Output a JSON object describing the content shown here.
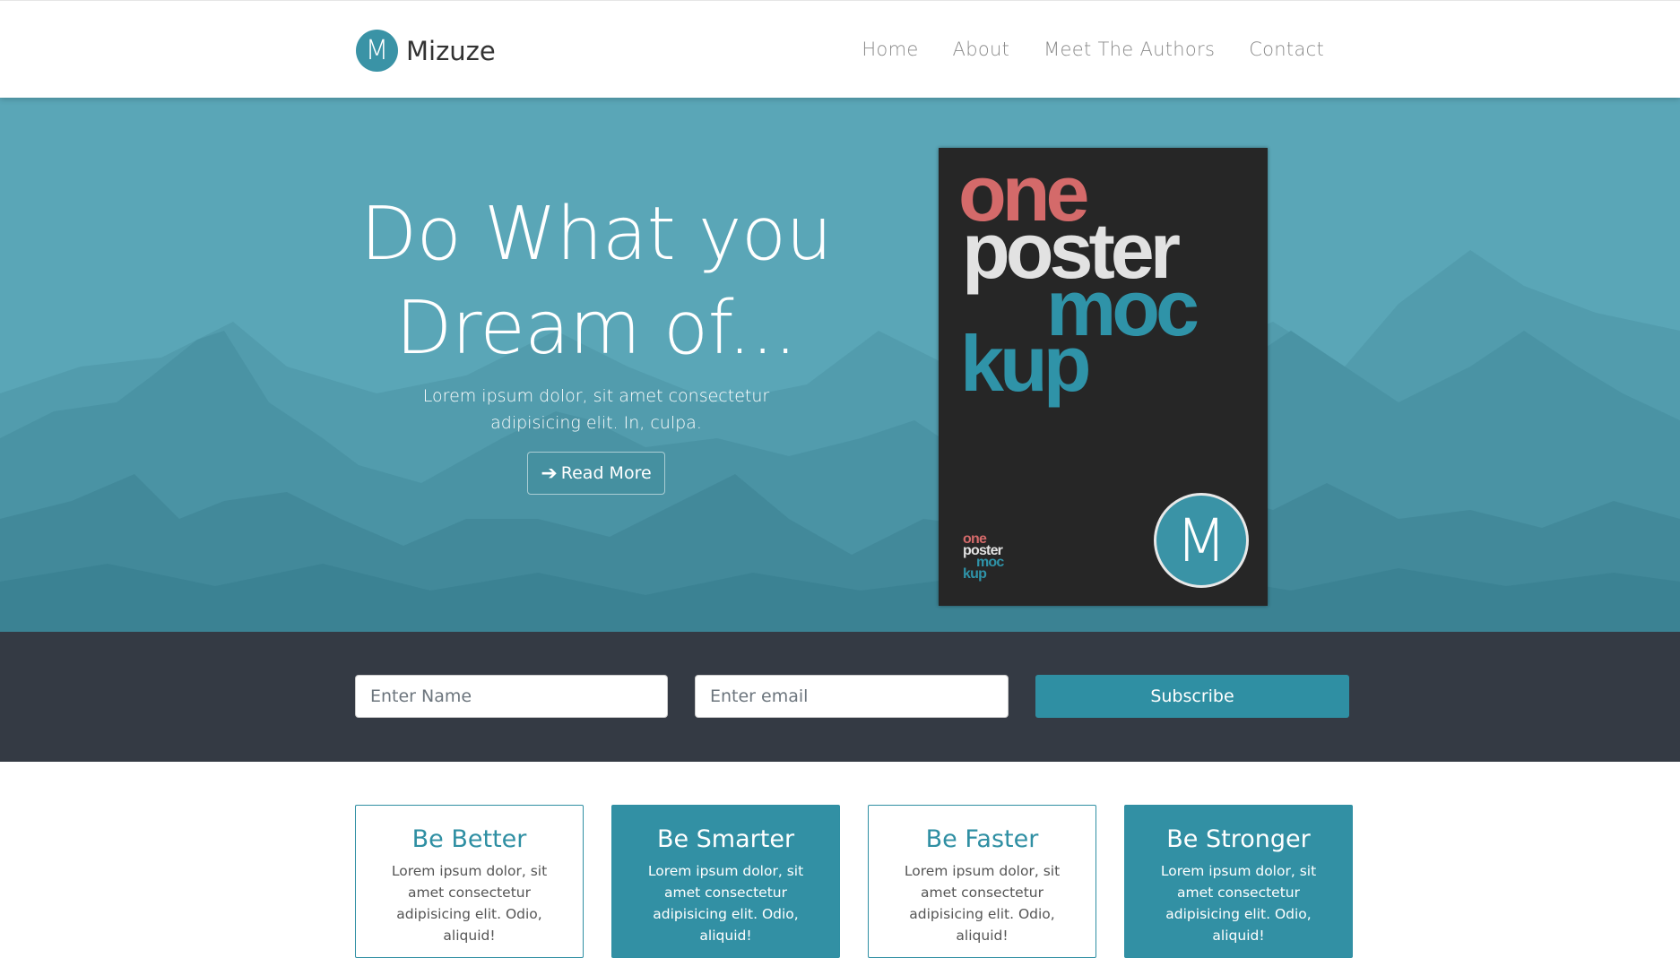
{
  "brand": {
    "logo_letter": "M",
    "name": "Mizuze"
  },
  "nav": {
    "items": [
      "Home",
      "About",
      "Meet The Authors",
      "Contact"
    ]
  },
  "hero": {
    "title_line1": "Do What you",
    "title_line2": "Dream of...",
    "subtitle": "Lorem ipsum dolor, sit amet consectetur adipisicing elit. In, culpa.",
    "button_label": "Read More",
    "button_icon": "arrow-right-icon",
    "background_color": "#5aa6b7"
  },
  "poster": {
    "words": [
      "one",
      "poster",
      "moc",
      "kup"
    ],
    "logo_letter": "M"
  },
  "subscribe": {
    "name_placeholder": "Enter Name",
    "email_placeholder": "Enter email",
    "button_label": "Subscribe",
    "background_color": "#343a44"
  },
  "features": [
    {
      "title": "Be Better",
      "text": "Lorem ipsum dolor, sit amet consectetur adipisicing elit. Odio, aliquid!",
      "style": "outline"
    },
    {
      "title": "Be Smarter",
      "text": "Lorem ipsum dolor, sit amet consectetur adipisicing elit. Odio, aliquid!",
      "style": "filled"
    },
    {
      "title": "Be Faster",
      "text": "Lorem ipsum dolor, sit amet consectetur adipisicing elit. Odio, aliquid!",
      "style": "outline"
    },
    {
      "title": "Be Stronger",
      "text": "Lorem ipsum dolor, sit amet consectetur adipisicing elit. Odio, aliquid!",
      "style": "filled"
    }
  ],
  "colors": {
    "accent": "#2f8fa3",
    "dark": "#343a44"
  }
}
